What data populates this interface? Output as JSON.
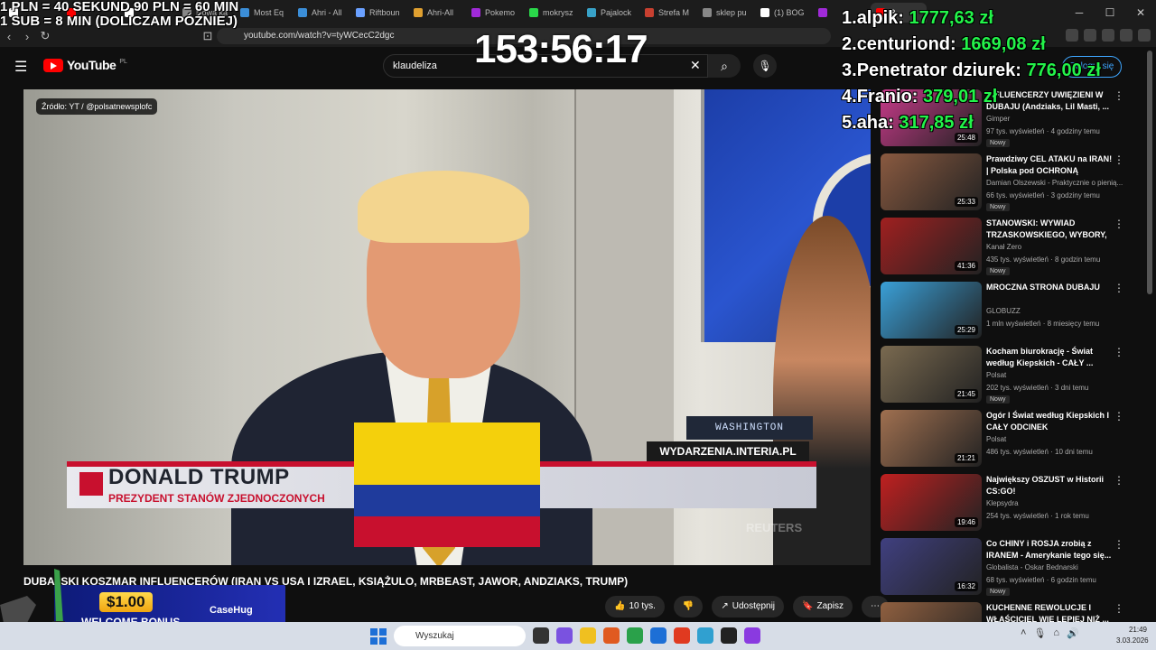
{
  "browser": {
    "tabs": [
      {
        "label": "",
        "color": "#ffffff"
      },
      {
        "label": "",
        "color": "#f00"
      },
      {
        "label": "",
        "color": "#ffffff"
      },
      {
        "label": "Nowa ka",
        "color": "#888"
      },
      {
        "label": "Most Eq",
        "color": "#3b8ed8"
      },
      {
        "label": "Ahri - All",
        "color": "#3b8ed8"
      },
      {
        "label": "Riftboun",
        "color": "#6aa0ff"
      },
      {
        "label": "Ahri-All",
        "color": "#e0a030"
      },
      {
        "label": "Pokemo",
        "color": "#a02ad8"
      },
      {
        "label": "mokrysz",
        "color": "#2ad84a"
      },
      {
        "label": "Pajalock",
        "color": "#38a2c8"
      },
      {
        "label": "Strefa M",
        "color": "#c84030"
      },
      {
        "label": "sklep pu",
        "color": "#888"
      },
      {
        "label": "(1) BOG",
        "color": "#ffffff"
      },
      {
        "label": "",
        "color": "#a02ad8"
      },
      {
        "label": "R",
        "color": "#f00"
      }
    ],
    "url": "youtube.com/watch?v=tyWCecC2dgc"
  },
  "youtube": {
    "logo_text": "YouTube",
    "country": "PL",
    "search_value": "klaudeliza",
    "signin_label": "Zaloguj się",
    "video": {
      "source_badge": "Źródło: YT / @polsatnewsplofc",
      "lower_third_name": "DONALD TRUMP",
      "lower_third_sub": "PREZYDENT STANÓW ZJEDNOCZONYCH",
      "wyd_label": "WYDARZENIA.INTERIA.PL",
      "washington_label": "WASHINGTON",
      "reuters_label": "REUTERS"
    },
    "title": "DUBAJSKI KOSZMAR INFLUENCERÓW (IRAN VS USA I IZRAEL, KSIĄŻULO, MRBEAST, JAWOR, ANDZIAKS, TRUMP)",
    "actions": {
      "likes": "10 tys.",
      "share": "Udostępnij",
      "save": "Zapisz"
    },
    "recommendations": [
      {
        "title": "INFLUENCERZY UWIĘZIENI W DUBAJU (Andziaks, Lil Masti, ...",
        "channel": "Gimper",
        "meta": "97 tys. wyświetleń · 4 godziny temu",
        "badge": "Nowy",
        "duration": "25:48",
        "color": "#c83a8a"
      },
      {
        "title": "Prawdziwy CEL ATAKU na IRAN! | Polska pod OCHRONĄ Francji...",
        "channel": "Damian Olszewski - Praktycznie o pienią...",
        "meta": "66 tys. wyświetleń · 3 godziny temu",
        "badge": "Nowy",
        "duration": "25:33",
        "color": "#8a5a40"
      },
      {
        "title": "STANOWSKI: WYWIAD TRZASKOWSKIEGO, WYBORY, ...",
        "channel": "Kanał Zero",
        "meta": "435 tys. wyświetleń · 8 godzin temu",
        "badge": "Nowy",
        "duration": "41:36",
        "color": "#a02020"
      },
      {
        "title": "MROCZNA STRONA DUBAJU",
        "channel": "GLOBUZZ",
        "meta": "1 mln wyświetleń · 8 miesięcy temu",
        "badge": "",
        "duration": "25:29",
        "color": "#3aa0d8"
      },
      {
        "title": "Kocham biurokrację - Świat według Kiepskich - CAŁY ...",
        "channel": "Polsat",
        "meta": "202 tys. wyświetleń · 3 dni temu",
        "badge": "Nowy",
        "duration": "21:45",
        "color": "#7a6a50"
      },
      {
        "title": "Ogór I Świat według Kiepskich I CAŁY ODCINEK",
        "channel": "Polsat",
        "meta": "486 tys. wyświetleń · 10 dni temu",
        "badge": "",
        "duration": "21:21",
        "color": "#a07050"
      },
      {
        "title": "Największy OSZUST w Historii CS:GO!",
        "channel": "Klepsydra",
        "meta": "254 tys. wyświetleń · 1 rok temu",
        "badge": "",
        "duration": "19:46",
        "color": "#c02020"
      },
      {
        "title": "Co CHINY i ROSJA zrobią z IRANEM - Amerykanie tego się...",
        "channel": "Globalista - Oskar Bednarski",
        "meta": "68 tys. wyświetleń · 6 godzin temu",
        "badge": "Nowy",
        "duration": "16:32",
        "color": "#404080"
      },
      {
        "title": "KUCHENNE REWOLUCJE I WŁAŚCICIEL WIE LEPIEJ NIŻ ...",
        "channel": "",
        "meta": "",
        "badge": "",
        "duration": "",
        "color": "#906040"
      }
    ]
  },
  "overlay": {
    "rates": [
      "1 PLN =  40 SEKUND 90 PLN = 60 MIN",
      "1 SUB = 8 MIN (DOLICZAM PÓŹNIEJ)"
    ],
    "timer": "153:56:17",
    "leaderboard": [
      {
        "rank": "1.",
        "name": "alpik:",
        "amount": "1777,63 zł"
      },
      {
        "rank": "2.",
        "name": "centuriond:",
        "amount": "1669,08 zł"
      },
      {
        "rank": "3.",
        "name": "Penetrator dziurek:",
        "amount": "776,00 zł"
      },
      {
        "rank": "4.",
        "name": "Franio:",
        "amount": "379,01 zł"
      },
      {
        "rank": "5.",
        "name": "aha:",
        "amount": "317,85 zł"
      }
    ],
    "promo": {
      "amount": "$1.00",
      "label": "WELCOME BONUS",
      "brand": "CaseHug"
    }
  },
  "taskbar": {
    "search_placeholder": "Wyszukaj",
    "time": "21:49",
    "date": "3.03.2026"
  },
  "colors": {
    "flag_yellow": "#f4d00c",
    "flag_blue": "#1f3b9c",
    "flag_red": "#c8102e"
  }
}
